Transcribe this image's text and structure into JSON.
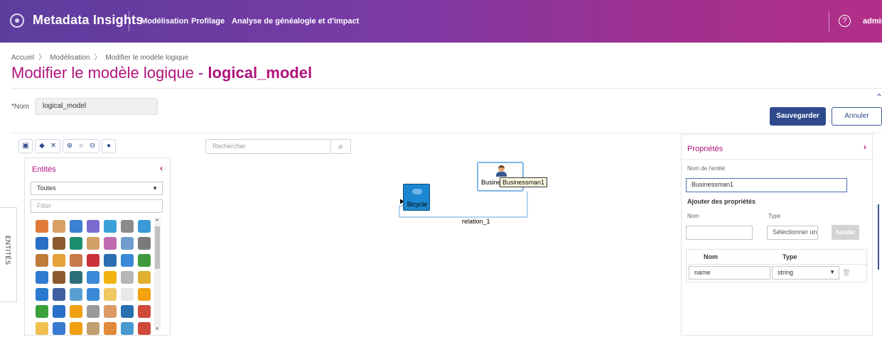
{
  "header": {
    "app_title": "Metadata Insights",
    "nav": [
      "Modélisation",
      "Profilage",
      "Analyse de généalogie et d'impact"
    ],
    "help_icon": "?",
    "user": "admin"
  },
  "breadcrumb": [
    "Accueil",
    "Modélisation",
    "Modifier le modèle logique"
  ],
  "page_title": {
    "prefix": "Modifier le modèle logique - ",
    "model": "logical_model"
  },
  "form": {
    "name_label": "*Nom",
    "name_value": "logical_model",
    "save_label": "Sauvegarder",
    "cancel_label": "Annuler"
  },
  "canvas": {
    "search_placeholder": "Rechercher",
    "toolbar_icons": [
      "fit-icon",
      "tag-icon",
      "delete-icon",
      "zoom-in-icon",
      "zoom-reset-icon",
      "zoom-out-icon",
      "camera-icon"
    ],
    "nodes": [
      {
        "label": "Bicycle"
      },
      {
        "label": "Busine"
      }
    ],
    "tooltip": "Businessman1",
    "relation": "relation_1"
  },
  "entities": {
    "side_tab": "ENTITÉS",
    "title": "Entités",
    "select_value": "Toutes",
    "filter_placeholder": "Filter",
    "icon_colors": [
      "#e07b39",
      "#d9a066",
      "#3a7fd1",
      "#7a6bd1",
      "#3aa0d8",
      "#8c8c8c",
      "#3a9ad8",
      "#2a6fc4",
      "#8a5a2e",
      "#1d8f6e",
      "#d3a066",
      "#c06bb0",
      "#6f9ccc",
      "#7a7a7a",
      "#c07a3a",
      "#e6a23c",
      "#c97a4a",
      "#c9323a",
      "#2b6fb0",
      "#3a8ad8",
      "#3f9a3f",
      "#2e7bd1",
      "#8a5a2e",
      "#2c6f7a",
      "#3a8ad8",
      "#f2b20f",
      "#b5b5b5",
      "#e0b030",
      "#2a7ad1",
      "#3f5fa0",
      "#5aa0d0",
      "#3a8ad8",
      "#f0c860",
      "#e8e8e8",
      "#f2a20f",
      "#3aa03a",
      "#2a70c8",
      "#f0a010",
      "#9a9a9a",
      "#d99a66",
      "#2a6fb0",
      "#d04a3a",
      "#f0c050",
      "#3a7ad1",
      "#f0a010",
      "#c0a070",
      "#e08a3a",
      "#4a9ad0",
      "#d04a3a"
    ]
  },
  "properties": {
    "title": "Propriétés",
    "entity_name_label": "Nom de l'entité",
    "entity_name_value": "Businessman1",
    "add_props_title": "Ajouter des propriétés",
    "col_name_label": "Nom",
    "col_type_label": "Type",
    "type_placeholder": "Sélectionner un",
    "add_button": "Ajouter",
    "table_headers": [
      "Nom",
      "Type"
    ],
    "rows": [
      {
        "name": "name",
        "type": "string"
      }
    ]
  }
}
